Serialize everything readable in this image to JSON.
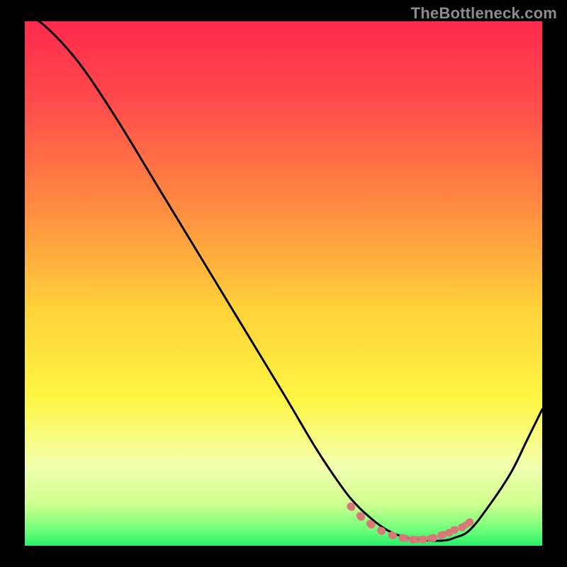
{
  "watermark": "TheBottleneck.com",
  "chart_data": {
    "type": "line",
    "title": "",
    "xlabel": "",
    "ylabel": "",
    "xlim": [
      0,
      100
    ],
    "ylim": [
      0,
      100
    ],
    "grid": false,
    "legend": false,
    "gradient_stops": [
      {
        "offset": 0.0,
        "color": "#ff2a4d"
      },
      {
        "offset": 0.15,
        "color": "#ff4a4c"
      },
      {
        "offset": 0.35,
        "color": "#ff8a41"
      },
      {
        "offset": 0.55,
        "color": "#ffd23a"
      },
      {
        "offset": 0.72,
        "color": "#fff642"
      },
      {
        "offset": 0.85,
        "color": "#f2ffb0"
      },
      {
        "offset": 0.92,
        "color": "#d0ff8f"
      },
      {
        "offset": 0.97,
        "color": "#6fff7a"
      },
      {
        "offset": 1.0,
        "color": "#27ef68"
      }
    ],
    "series": [
      {
        "name": "bottleneck-curve",
        "color": "#000000",
        "x": [
          0,
          4,
          8,
          12,
          18,
          26,
          34,
          42,
          50,
          56,
          60,
          63,
          66,
          70,
          74,
          78,
          81,
          83,
          86,
          90,
          94,
          97,
          100
        ],
        "y": [
          102,
          99,
          95,
          90,
          81,
          68,
          55,
          42,
          29,
          19,
          13,
          9,
          6,
          3,
          1.5,
          1,
          1,
          1.5,
          3,
          8,
          14,
          20,
          26
        ],
        "_comment": "y is percent-from-bottom; curve drops from top-left, bottoms out ~75-80% of width, rises again"
      },
      {
        "name": "highlight-dots",
        "color": "#d87878",
        "type": "scatter",
        "x": [
          63,
          65,
          67,
          69,
          71,
          73,
          75,
          77,
          79,
          80.5,
          82,
          83,
          84.5,
          86
        ],
        "y": [
          7.5,
          5.5,
          4.0,
          2.8,
          2.0,
          1.5,
          1.2,
          1.2,
          1.5,
          2.0,
          2.5,
          3.0,
          3.5,
          4.5
        ],
        "_comment": "pink dotted segment along the trough of the curve"
      }
    ]
  }
}
